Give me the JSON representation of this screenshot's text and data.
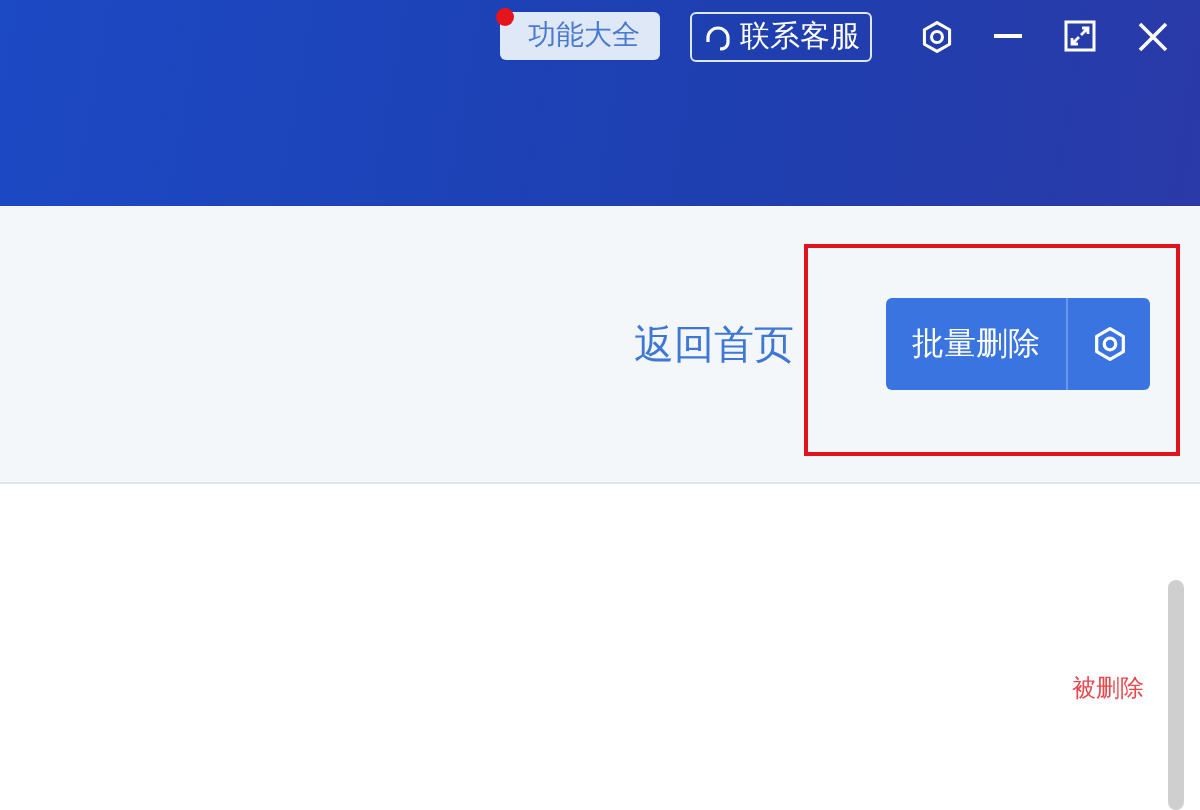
{
  "header": {
    "feature_button": {
      "label": "功能大全",
      "notification_dot": true
    },
    "support_button": {
      "label": "联系客服"
    }
  },
  "toolbar": {
    "home_link": "返回首页",
    "batch_delete_button": "批量删除"
  },
  "content": {
    "status_text": "被删除"
  }
}
